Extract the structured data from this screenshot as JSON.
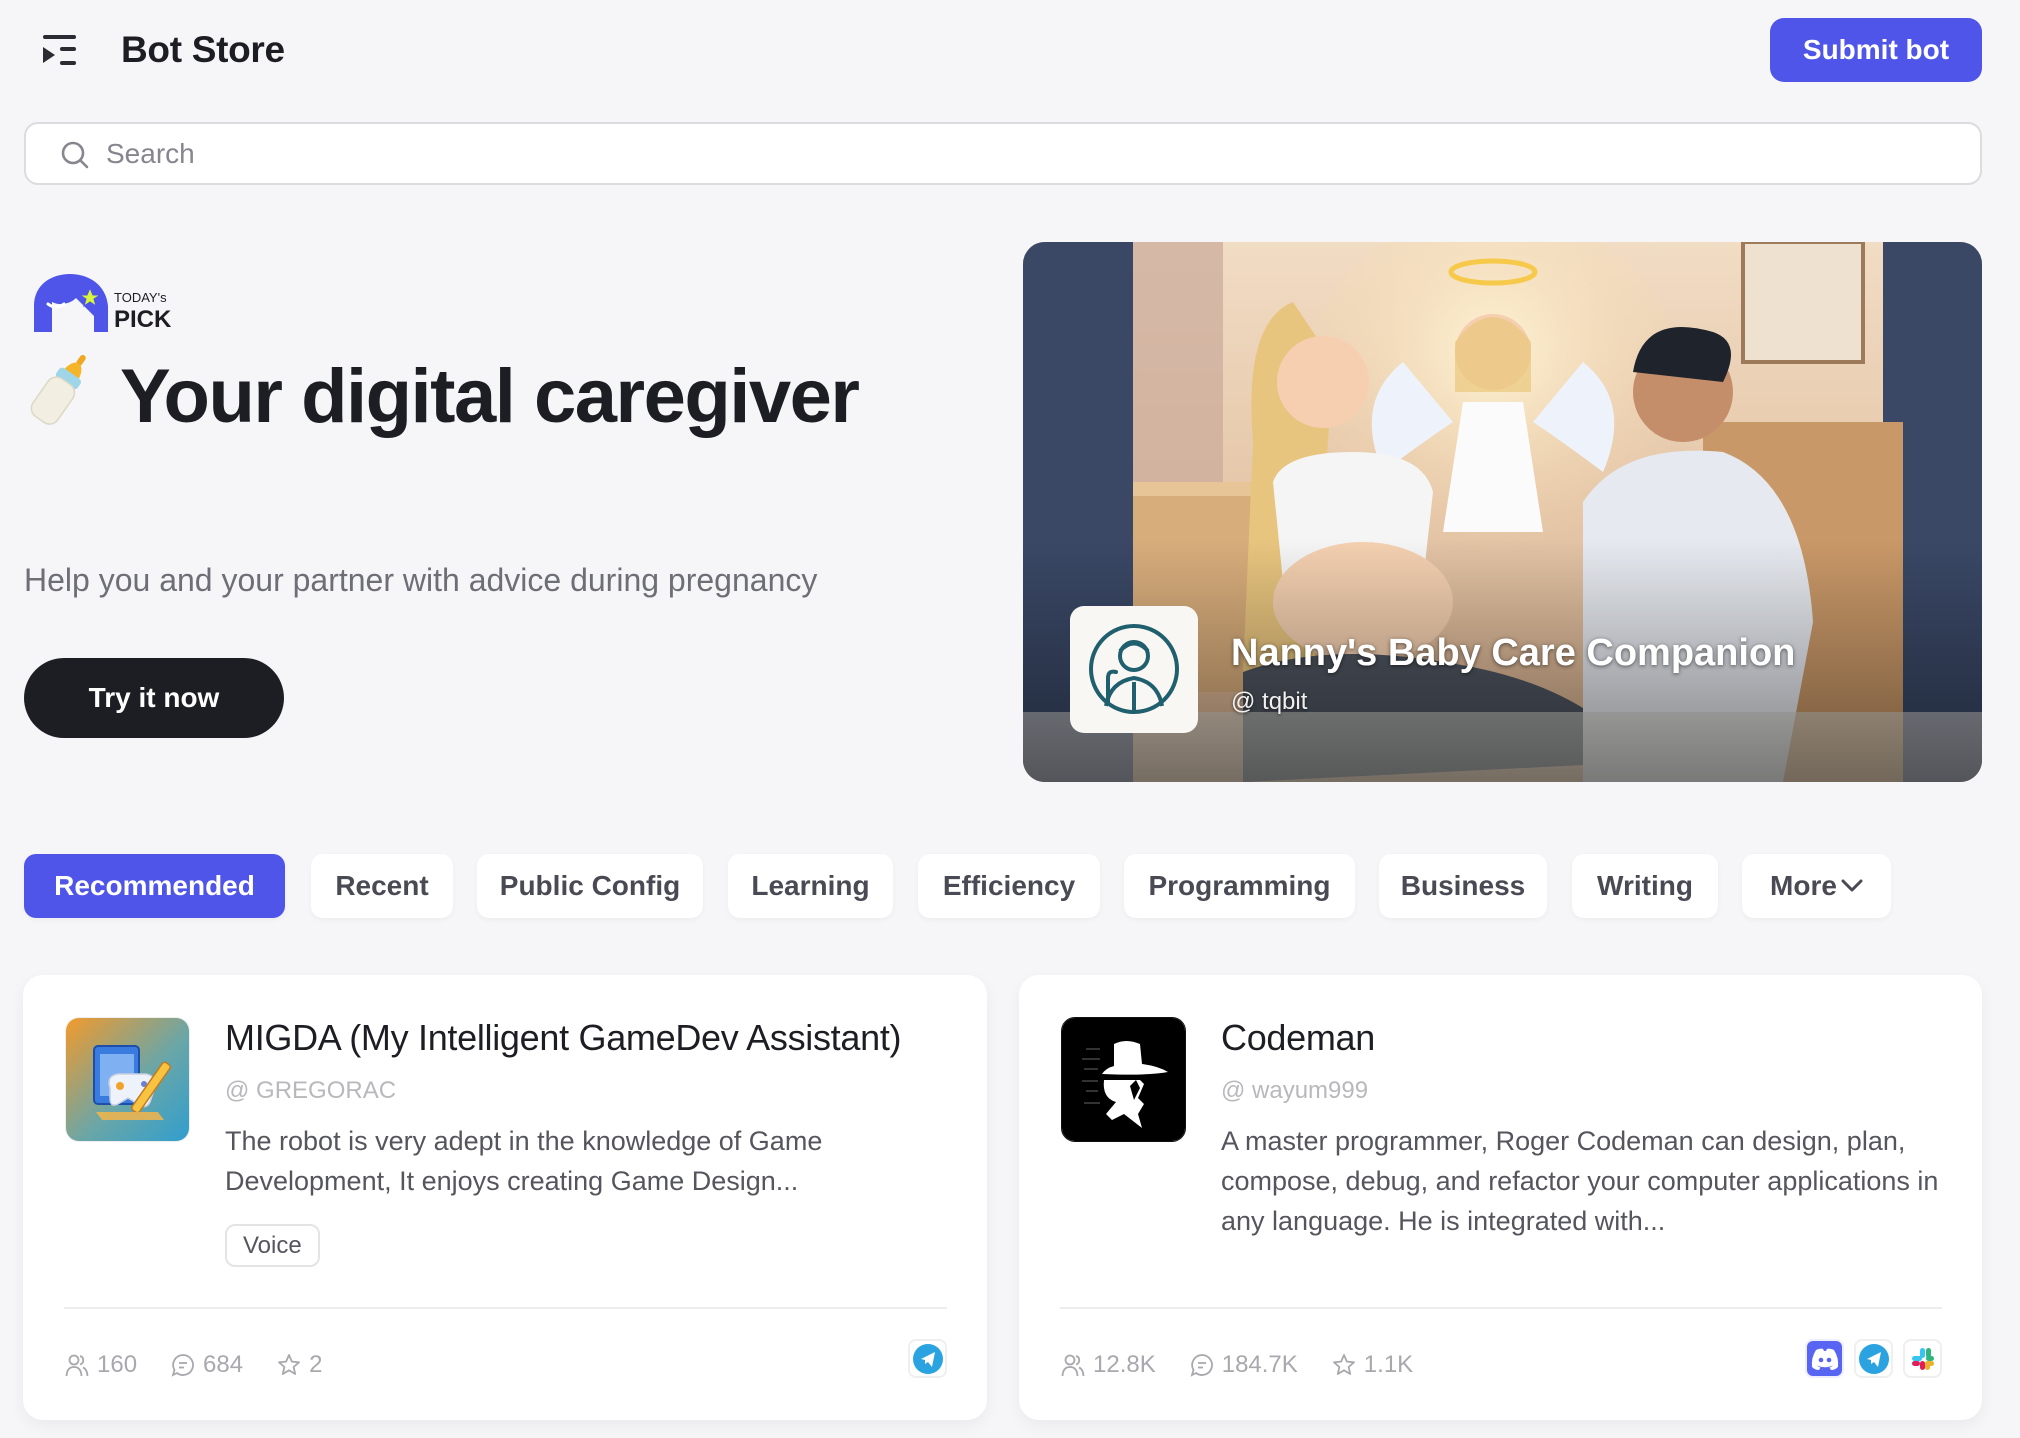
{
  "header": {
    "title": "Bot Store",
    "submit_label": "Submit bot"
  },
  "search": {
    "placeholder": "Search",
    "value": ""
  },
  "hero": {
    "badge": {
      "line1": "TODAY's",
      "line2": "PICK"
    },
    "emoji": "baby-bottle",
    "title": "Your digital caregiver",
    "subtitle": "Help you and your partner with advice during pregnancy",
    "cta_label": "Try it now",
    "featured": {
      "name": "Nanny's Baby Care Companion",
      "handle": "tqbit"
    }
  },
  "tabs": [
    {
      "label": "Recommended",
      "active": true
    },
    {
      "label": "Recent",
      "active": false
    },
    {
      "label": "Public Config",
      "active": false
    },
    {
      "label": "Learning",
      "active": false
    },
    {
      "label": "Efficiency",
      "active": false
    },
    {
      "label": "Programming",
      "active": false
    },
    {
      "label": "Business",
      "active": false
    },
    {
      "label": "Writing",
      "active": false
    },
    {
      "label": "More",
      "active": false
    }
  ],
  "bots": [
    {
      "name": "MIGDA (My Intelligent GameDev Assistant)",
      "handle": "GREGORAC",
      "description": "The robot is very adept in the knowledge of Game Development, It enjoys creating Game Design...",
      "tags": [
        "Voice"
      ],
      "stats": {
        "users": "160",
        "messages": "684",
        "stars": "2"
      },
      "platforms": [
        "telegram"
      ]
    },
    {
      "name": "Codeman",
      "handle": "wayum999",
      "description": "A master programmer, Roger Codeman can design, plan, compose, debug, and refactor your computer applications in any language. He is integrated with...",
      "tags": [],
      "stats": {
        "users": "12.8K",
        "messages": "184.7K",
        "stars": "1.1K"
      },
      "platforms": [
        "discord",
        "telegram",
        "slack"
      ]
    }
  ],
  "colors": {
    "accent": "#4f55e8",
    "background": "#f6f6f8",
    "dark": "#1d1d24",
    "telegram": "#2aa3e0",
    "discord": "#5865f2"
  }
}
